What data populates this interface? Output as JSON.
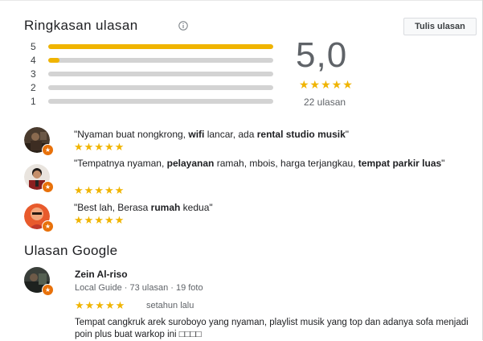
{
  "summary": {
    "title": "Ringkasan ulasan",
    "info_icon": "info-icon",
    "write_button": "Tulis ulasan",
    "bars": [
      {
        "label": "5",
        "fraction": 1.0
      },
      {
        "label": "4",
        "fraction": 0.05
      },
      {
        "label": "3",
        "fraction": 0.0
      },
      {
        "label": "2",
        "fraction": 0.0
      },
      {
        "label": "1",
        "fraction": 0.0
      }
    ],
    "rating": "5,0",
    "stars": "★★★★★",
    "count": "22 ulasan"
  },
  "snippets": [
    {
      "parts": [
        {
          "t": "\"Nyaman buat nongkrong, ",
          "b": false
        },
        {
          "t": "wifi",
          "b": true
        },
        {
          "t": " lancar, ada ",
          "b": false
        },
        {
          "t": "rental studio musik",
          "b": true
        },
        {
          "t": "\"",
          "b": false
        }
      ],
      "stars": "★★★★★"
    },
    {
      "parts": [
        {
          "t": "\"Tempatnya nyaman, ",
          "b": false
        },
        {
          "t": "pelayanan",
          "b": true
        },
        {
          "t": " ramah, mbois, harga terjangkau, ",
          "b": false
        },
        {
          "t": "tempat parkir luas",
          "b": true
        },
        {
          "t": "\"",
          "b": false
        }
      ],
      "stars": "★★★★★"
    },
    {
      "parts": [
        {
          "t": "\"Best lah, Berasa ",
          "b": false
        },
        {
          "t": "rumah",
          "b": true
        },
        {
          "t": " kedua\"",
          "b": false
        }
      ],
      "stars": "★★★★★"
    }
  ],
  "google_reviews": {
    "title": "Ulasan Google",
    "items": [
      {
        "name": "Zein Al-riso",
        "meta": "Local Guide · 73 ulasan · 19 foto",
        "stars": "★★★★★",
        "time": "setahun lalu",
        "text": "Tempat cangkruk arek suroboyo yang nyaman, playlist musik yang top dan adanya sofa menjadi poin plus buat warkop ini □□□□"
      }
    ]
  },
  "colors": {
    "star": "#f0b400",
    "bar_track": "#d3d3d3",
    "badge": "#e8710a"
  }
}
